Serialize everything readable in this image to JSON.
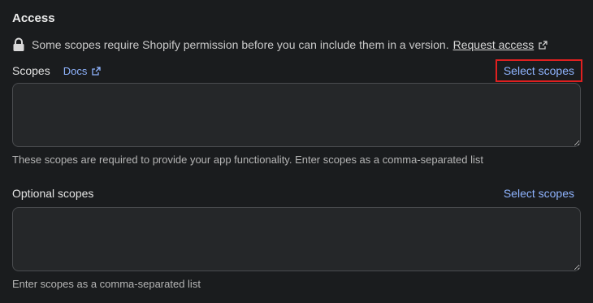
{
  "access": {
    "title": "Access",
    "notice": "Some scopes require Shopify permission before you can include them in a version.",
    "request_access": "Request access"
  },
  "scopes": {
    "label": "Scopes",
    "docs": "Docs",
    "select": "Select scopes",
    "value": "",
    "help": "These scopes are required to provide your app functionality. Enter scopes as a comma-separated list"
  },
  "optional_scopes": {
    "label": "Optional scopes",
    "select": "Select scopes",
    "value": "",
    "help": "Enter scopes as a comma-separated list"
  },
  "colors": {
    "background": "#1a1c1e",
    "link": "#8fb4ff",
    "highlight": "#e02020"
  }
}
